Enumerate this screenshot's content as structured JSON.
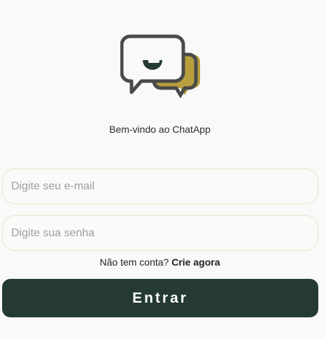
{
  "welcome_text": "Bem-vindo ao ChatApp",
  "form": {
    "email_placeholder": "Digite seu e-mail",
    "password_placeholder": "Digite sua senha",
    "submit_label": "Entrar"
  },
  "signup": {
    "prompt": "Não tem conta?",
    "link_label": "Crie agora"
  },
  "colors": {
    "primary_dark": "#243a33",
    "accent_gold": "#b89e3c",
    "icon_gray": "#4a4a4a",
    "field_border": "#e7e6c9",
    "background": "#f9f9f9"
  },
  "icons": {
    "logo": "chat-bubbles-logo-icon"
  }
}
